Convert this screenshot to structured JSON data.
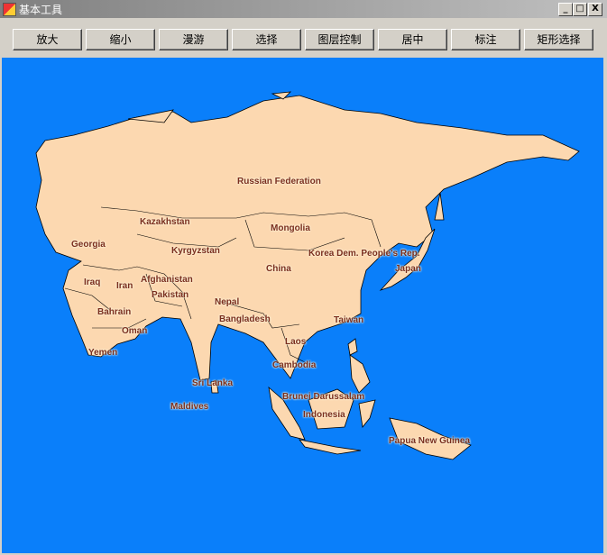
{
  "window": {
    "title": "基本工具",
    "minimize": "_",
    "maximize": "□",
    "close": "X"
  },
  "toolbar": [
    "放大",
    "缩小",
    "漫游",
    "选择",
    "图层控制",
    "居中",
    "标注",
    "矩形选择"
  ],
  "colors": {
    "water": "#0a7ffa",
    "land": "#fcd8b0",
    "label": "#7a2e1e"
  },
  "map_labels": [
    "Russian Federation",
    "Kazakhstan",
    "Mongolia",
    "Georgia",
    "Kyrgyzstan",
    "China",
    "Korea Dem. People's Rep.",
    "Japan",
    "Iraq",
    "Iran",
    "Afghanistan",
    "Pakistan",
    "Nepal",
    "Bahrain",
    "Bangladesh",
    "Taiwan",
    "Oman",
    "Laos",
    "Yemen",
    "Cambodia",
    "Sri Lanka",
    "Brunei Darussalam",
    "Maldives",
    "Indonesia",
    "Papua New Guinea"
  ]
}
